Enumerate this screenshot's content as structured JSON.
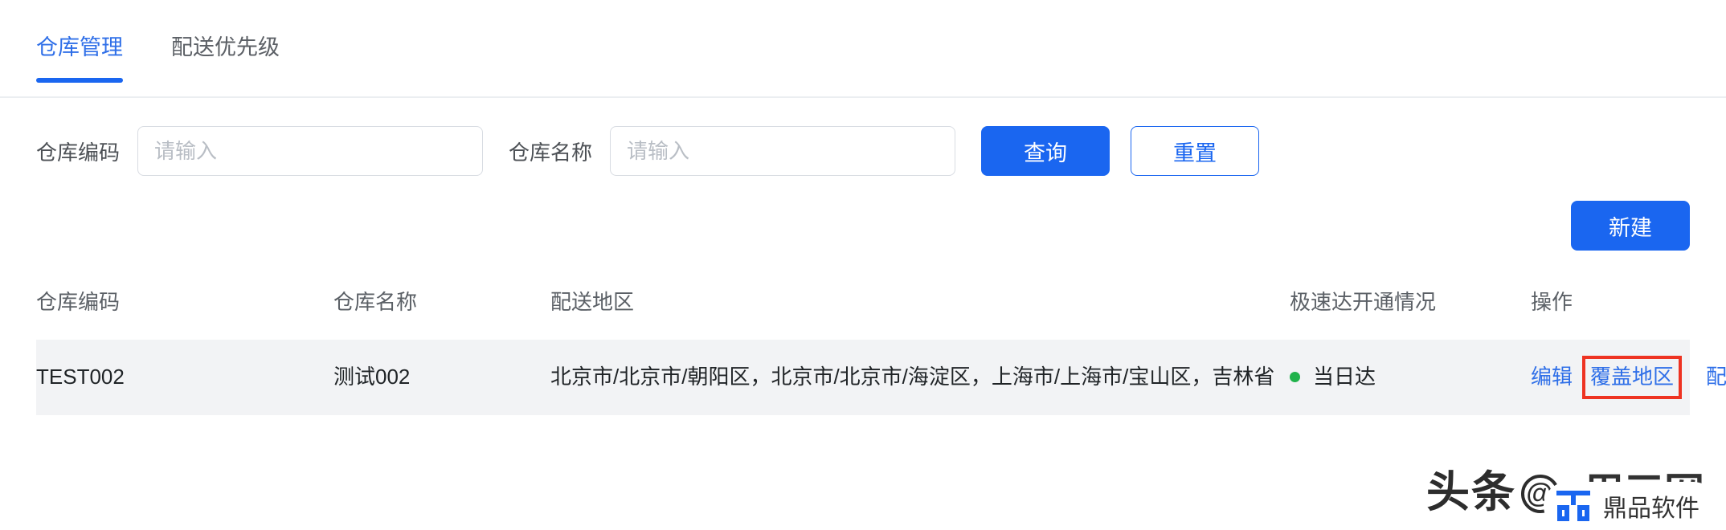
{
  "tabs": [
    {
      "label": "仓库管理",
      "active": true
    },
    {
      "label": "配送优先级",
      "active": false
    }
  ],
  "search": {
    "code_label": "仓库编码",
    "code_placeholder": "请输入",
    "code_value": "",
    "name_label": "仓库名称",
    "name_placeholder": "请输入",
    "name_value": "",
    "query_button": "查询",
    "reset_button": "重置"
  },
  "toolbar": {
    "create_button": "新建"
  },
  "table": {
    "headers": {
      "code": "仓库编码",
      "name": "仓库名称",
      "region": "配送地区",
      "status": "极速达开通情况",
      "ops": "操作"
    },
    "rows": [
      {
        "code": "TEST002",
        "name": "测试002",
        "region": "北京市/北京市/朝阳区，北京市/北京市/海淀区，上海市/上海市/宝山区，吉林省",
        "status": "当日达",
        "status_color": "#20b24b",
        "ops": [
          {
            "label": "编辑",
            "highlighted": false
          },
          {
            "label": "覆盖地区",
            "highlighted": true
          },
          {
            "label": "配送时效",
            "highlighted": false
          }
        ]
      }
    ]
  },
  "watermark": {
    "head": "头条",
    "tail": "用三网",
    "brand": "鼎品软件"
  },
  "colors": {
    "accent": "#1a66f0",
    "link": "#2f6fe8",
    "highlight_box": "#ee3322",
    "row_bg": "#f2f3f5",
    "status_green": "#20b24b"
  }
}
